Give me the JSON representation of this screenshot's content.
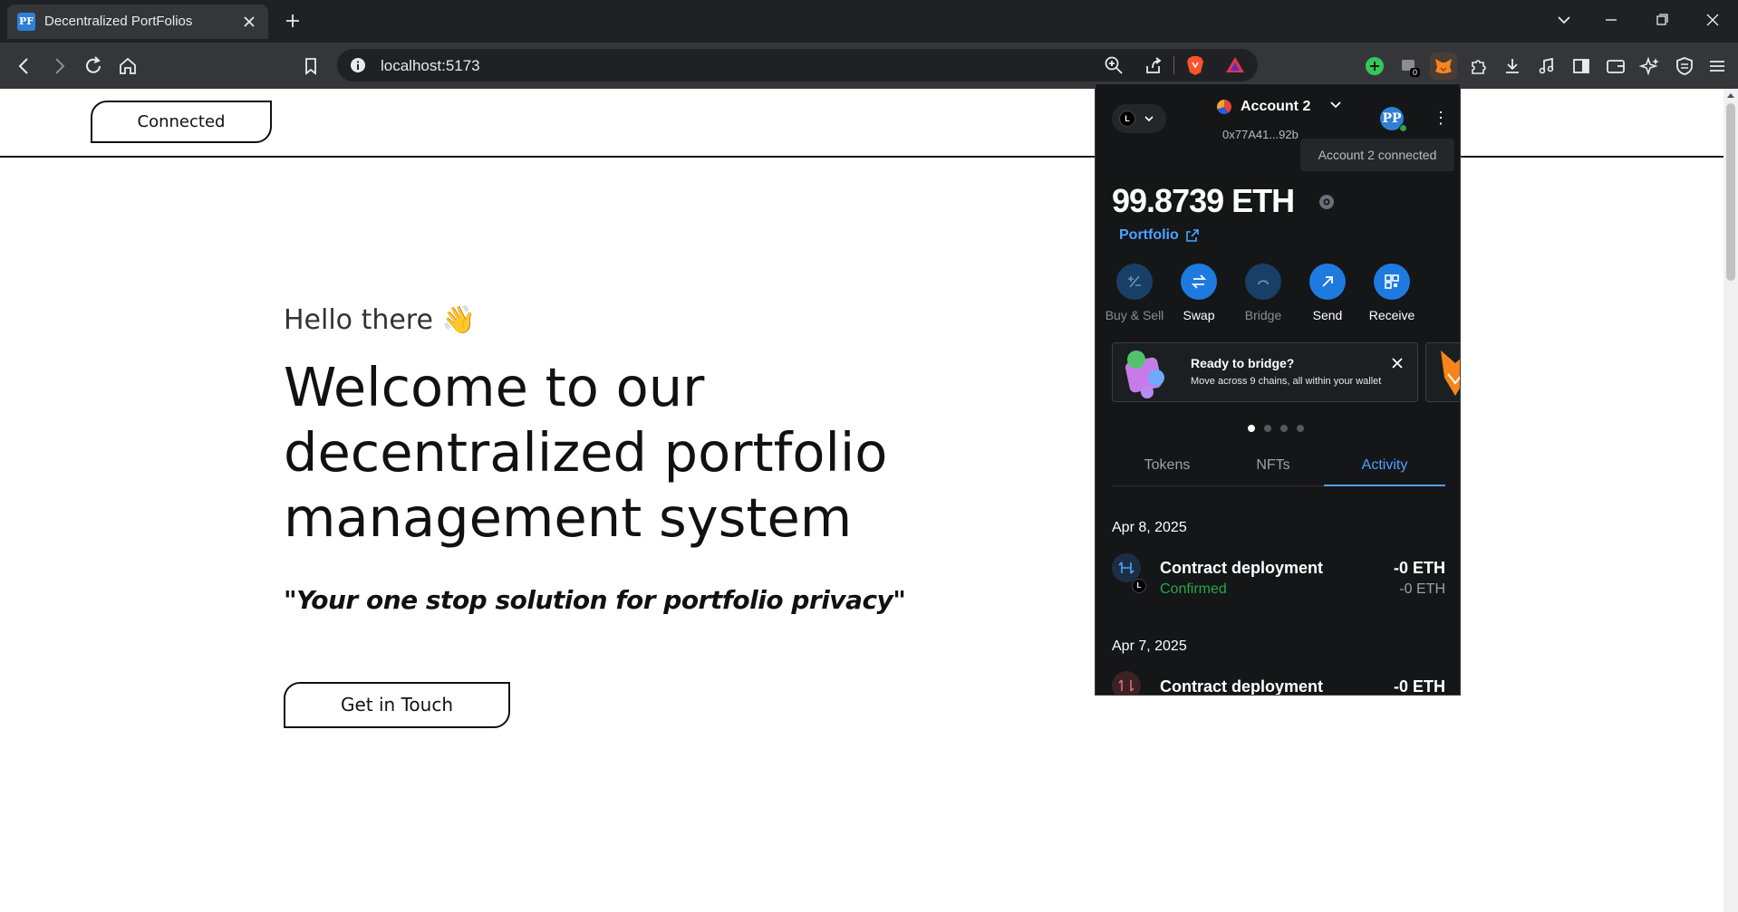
{
  "browser": {
    "tab_title": "Decentralized PortFolios",
    "tab_favicon": "PF",
    "url": "localhost:5173"
  },
  "page": {
    "connected_label": "Connected",
    "hello": "Hello there 👋",
    "headline": "Welcome to our decentralized portfolio management system",
    "tagline": "\"Your one stop solution for portfolio privacy\"",
    "cta_label": "Get in Touch"
  },
  "wallet": {
    "network_badge": "L",
    "account_name": "Account 2",
    "account_address": "0x77A41...92b",
    "profile_initials": "PP",
    "tooltip": "Account 2 connected",
    "balance": "99.8739 ETH",
    "portfolio_link": "Portfolio",
    "actions": [
      {
        "label": "Buy & Sell",
        "enabled": false
      },
      {
        "label": "Swap",
        "enabled": true
      },
      {
        "label": "Bridge",
        "enabled": false
      },
      {
        "label": "Send",
        "enabled": true
      },
      {
        "label": "Receive",
        "enabled": true
      }
    ],
    "banner": {
      "title": "Ready to bridge?",
      "subtitle": "Move across 9 chains, all within your wallet"
    },
    "tabs": [
      "Tokens",
      "NFTs",
      "Activity"
    ],
    "active_tab": "Activity",
    "activity": [
      {
        "date": "Apr 8, 2025",
        "title": "Contract deployment",
        "status": "Confirmed",
        "amount": "-0 ETH",
        "amount_secondary": "-0 ETH"
      },
      {
        "date": "Apr 7, 2025",
        "title": "Contract deployment",
        "amount": "-0 ETH"
      }
    ]
  },
  "colors": {
    "accent": "#4da2ff",
    "action_blue": "#1f7ae0",
    "confirmed_green": "#28a745",
    "wallet_bg": "#141618"
  }
}
